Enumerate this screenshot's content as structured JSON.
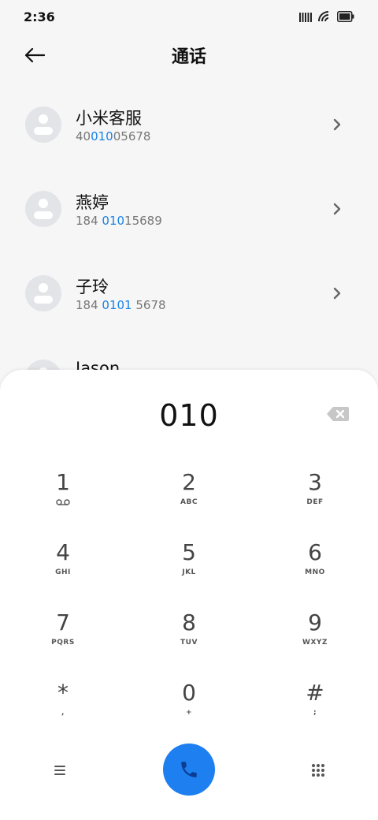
{
  "status_bar": {
    "time": "2:36",
    "icons": [
      "signal-icon",
      "wifi-icon",
      "battery-icon"
    ]
  },
  "header": {
    "title": "通话",
    "back_icon": "arrow-left-icon"
  },
  "contacts": [
    {
      "name": "小米客服",
      "number_pre": "40",
      "number_hl": "010",
      "number_post": "05678"
    },
    {
      "name": "燕婷",
      "number_pre": "184 ",
      "number_hl": "010",
      "number_post": "15689"
    },
    {
      "name": "子玲",
      "number_pre": "184 ",
      "number_hl": "0101",
      "number_post": " 5678"
    },
    {
      "name": "Jason",
      "number_pre": "",
      "number_hl": "",
      "number_post": ""
    }
  ],
  "dialer": {
    "number": "010",
    "keys": [
      {
        "digit": "1",
        "letters": ""
      },
      {
        "digit": "2",
        "letters": "ABC"
      },
      {
        "digit": "3",
        "letters": "DEF"
      },
      {
        "digit": "4",
        "letters": "GHI"
      },
      {
        "digit": "5",
        "letters": "JKL"
      },
      {
        "digit": "6",
        "letters": "MNO"
      },
      {
        "digit": "7",
        "letters": "PQRS"
      },
      {
        "digit": "8",
        "letters": "TUV"
      },
      {
        "digit": "9",
        "letters": "WXYZ"
      },
      {
        "digit": "*",
        "letters": ","
      },
      {
        "digit": "0",
        "letters": "+"
      },
      {
        "digit": "#",
        "letters": ";"
      }
    ]
  },
  "colors": {
    "accent": "#1a82e8",
    "call_button": "#1e7ff0",
    "background": "#f6f6f6",
    "panel": "#ffffff"
  }
}
